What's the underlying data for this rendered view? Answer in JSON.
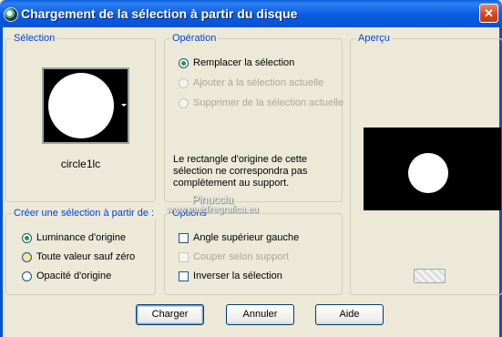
{
  "window": {
    "title": "Chargement de la sélection à partir du disque",
    "close_label": "✕"
  },
  "selection_group": {
    "legend": "Sélection",
    "selected_name": "circle1lc"
  },
  "operation_group": {
    "legend": "Opération",
    "options": [
      {
        "label": "Remplacer la sélection",
        "selected": true,
        "enabled": true
      },
      {
        "label": "Ajouter à la sélection actuelle",
        "selected": false,
        "enabled": false
      },
      {
        "label": "Supprimer de la sélection actuelle",
        "selected": false,
        "enabled": false
      }
    ],
    "note": "Le rectangle d'origine de cette sélection ne correspondra pas complètement au support."
  },
  "preview_group": {
    "legend": "Aperçu"
  },
  "create_group": {
    "legend": "Créer une sélection à partir de :",
    "options": [
      {
        "label": "Luminance d'origine",
        "selected": true
      },
      {
        "label": "Toute valeur sauf zéro",
        "selected": false
      },
      {
        "label": "Opacité d'origine",
        "selected": false
      }
    ]
  },
  "options_group": {
    "legend": "Options",
    "checks": [
      {
        "label": "Angle supérieur gauche",
        "checked": false,
        "enabled": true
      },
      {
        "label": "Couper selon support",
        "checked": false,
        "enabled": false
      },
      {
        "label": "Inverser la sélection",
        "checked": false,
        "enabled": true
      }
    ]
  },
  "watermark": {
    "name": "Pinuccia",
    "url": "www.maidiregrafica.eu"
  },
  "buttons": {
    "load": "Charger",
    "cancel": "Annuler",
    "help": "Aide"
  },
  "colors": {
    "titlebar": "#0a5ce0",
    "legend_text": "#0046d5",
    "dialog_bg": "#ece9d8"
  }
}
